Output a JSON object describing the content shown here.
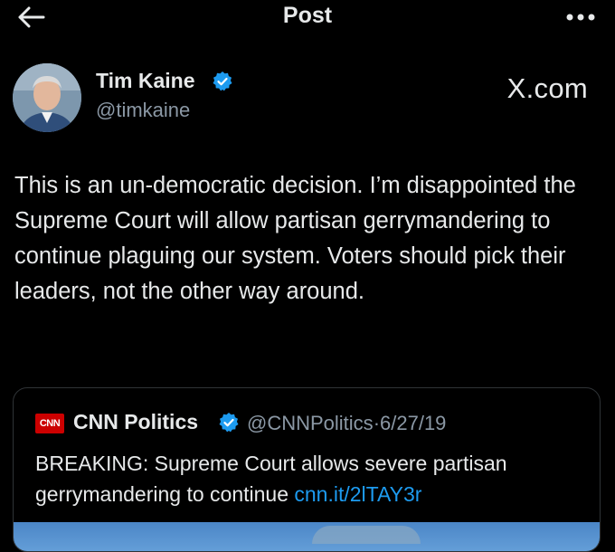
{
  "topbar": {
    "title": "Post"
  },
  "post": {
    "author_name": "Tim Kaine",
    "author_handle": "@timkaine",
    "source_label": "X.com",
    "text": "This is an un-democratic decision. I’m disappointed the Supreme Court will allow partisan gerrymandering to continue plaguing our system. Voters should pick their leaders, not the other way around."
  },
  "quote": {
    "logo_text": "CNN",
    "name": "CNN Politics",
    "handle": "@CNNPolitics",
    "separator": "·",
    "date": "6/27/19",
    "text": "BREAKING: Supreme Court allows severe partisan gerrymandering to continue",
    "link": "cnn.it/2lTAY3r"
  },
  "colors": {
    "background": "#000000",
    "text": "#e7e9ea",
    "secondary_text": "#8b98a5",
    "link": "#1d9bf0",
    "verified": "#1d9bf0",
    "border": "#2f3336"
  },
  "icons": {
    "back": "arrow-left-icon",
    "more": "more-horizontal-icon",
    "verified": "verified-badge-icon"
  }
}
